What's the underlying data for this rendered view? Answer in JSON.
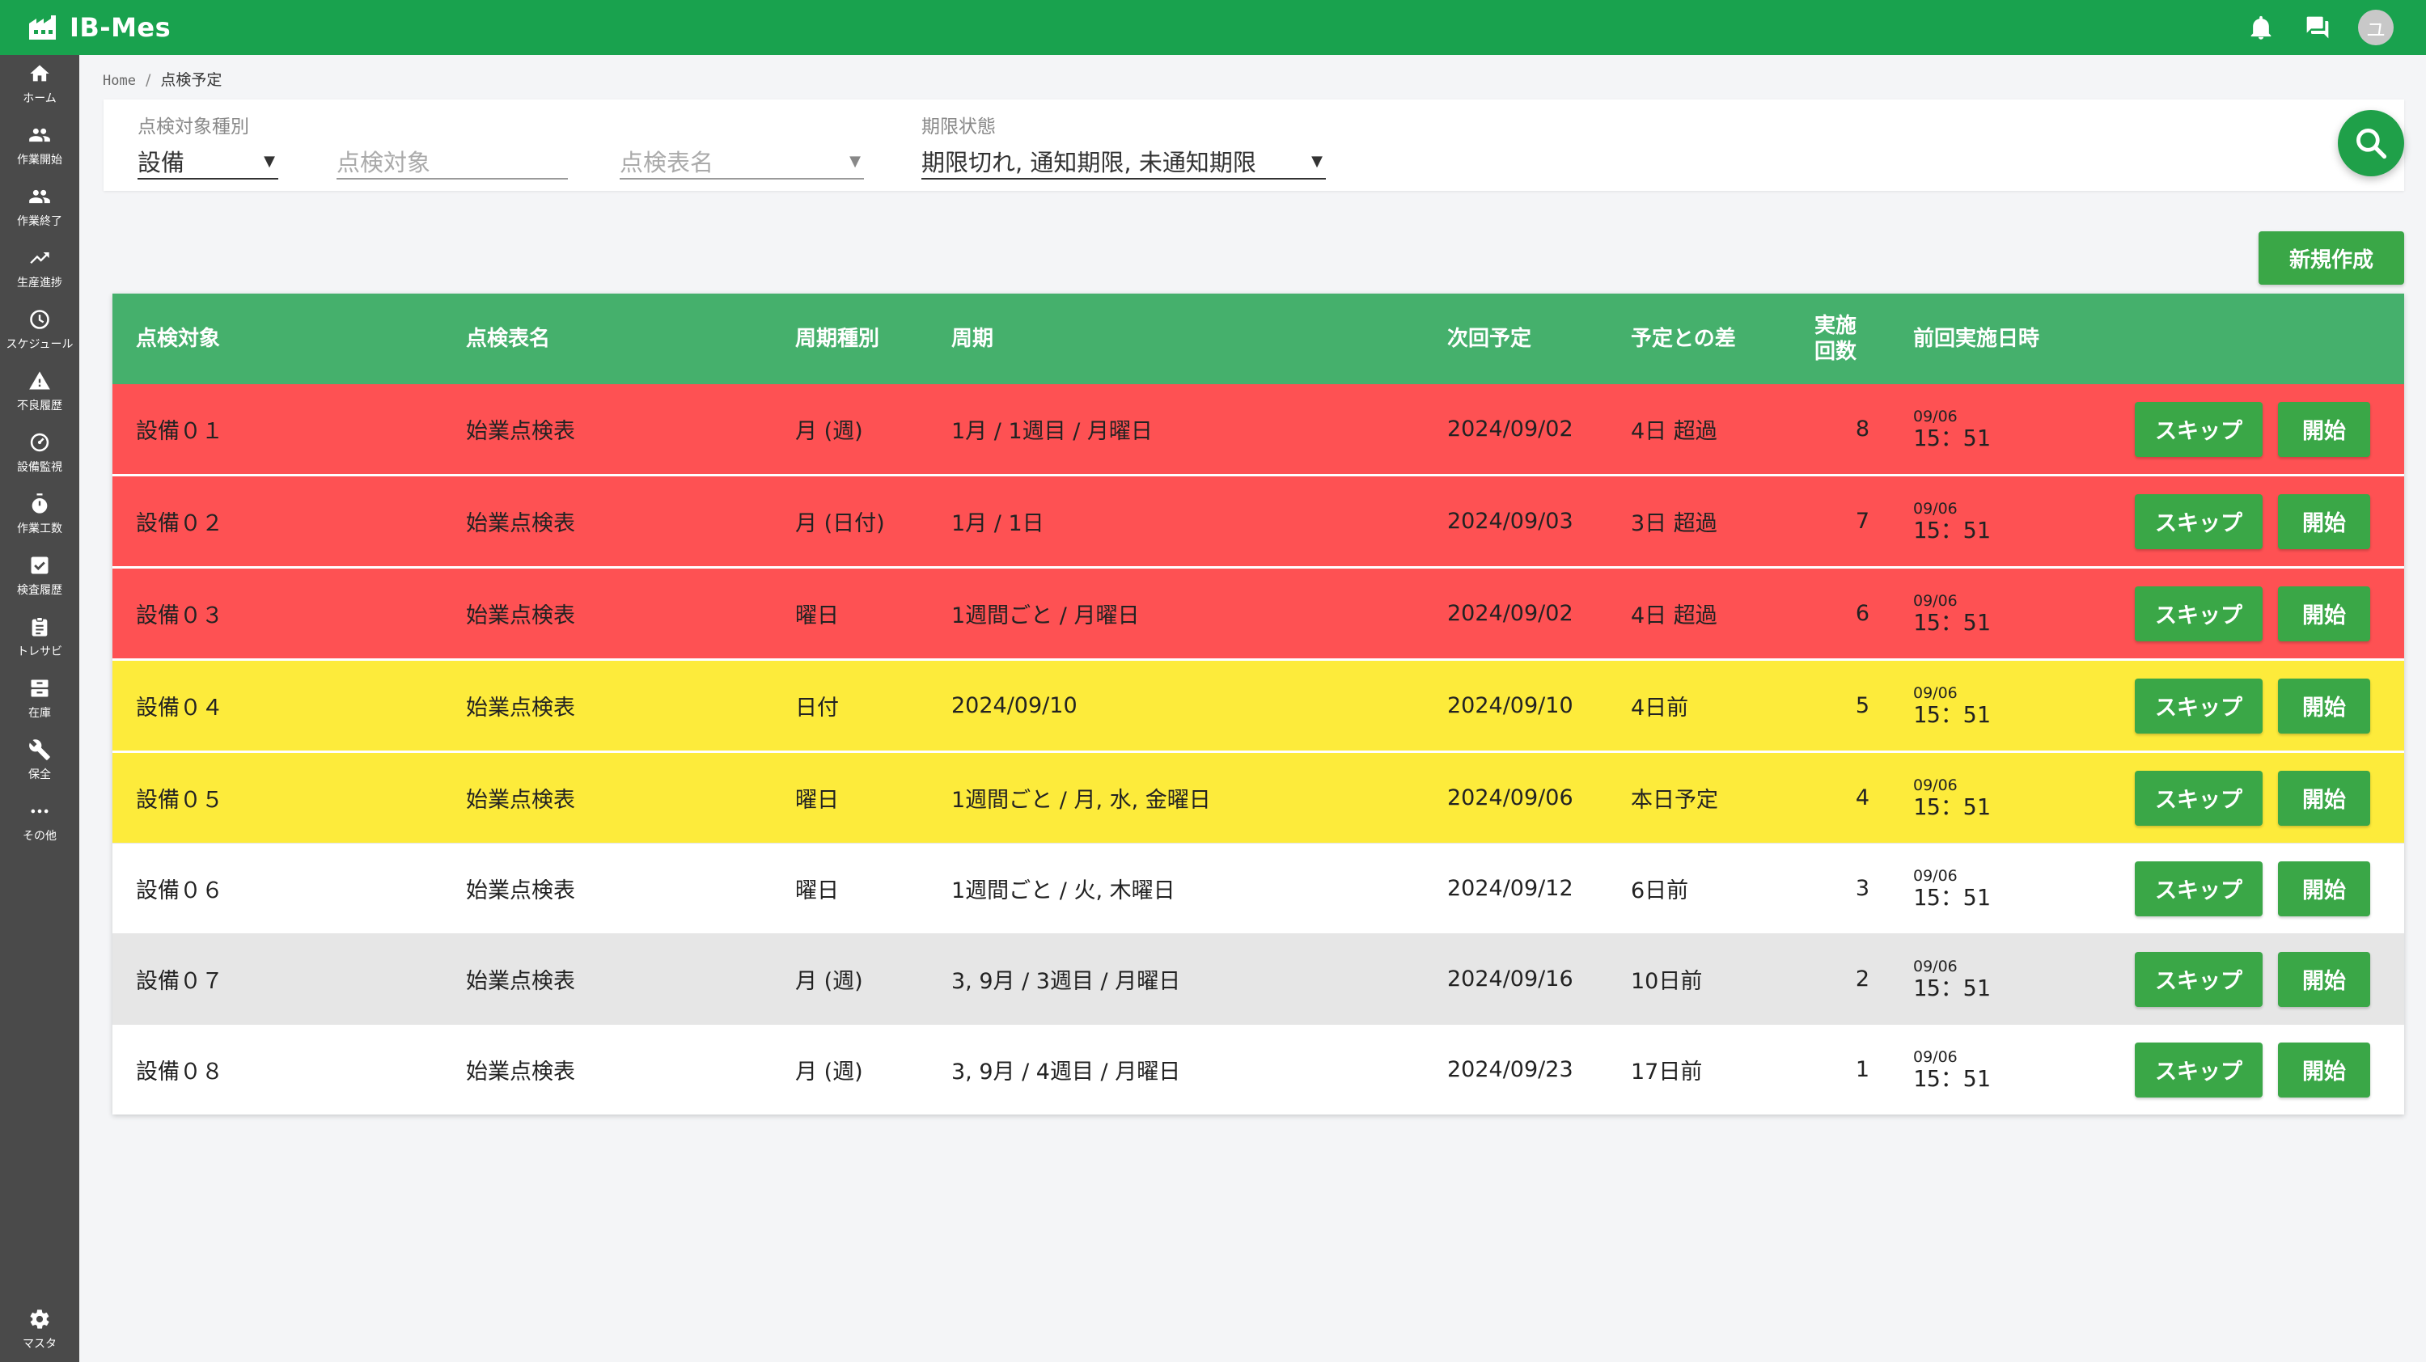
{
  "app": {
    "title": "IB-Mes",
    "avatar_initial": "ユ"
  },
  "sidebar": {
    "items": [
      {
        "label": "ホーム",
        "icon": "home-icon"
      },
      {
        "label": "作業開始",
        "icon": "people-icon"
      },
      {
        "label": "作業終了",
        "icon": "people-icon"
      },
      {
        "label": "生産進捗",
        "icon": "trending-up-icon"
      },
      {
        "label": "スケジュール",
        "icon": "clock-icon"
      },
      {
        "label": "不良履歴",
        "icon": "warning-icon"
      },
      {
        "label": "設備監視",
        "icon": "gauge-icon"
      },
      {
        "label": "作業工数",
        "icon": "stopwatch-icon"
      },
      {
        "label": "検査履歴",
        "icon": "checkbox-icon"
      },
      {
        "label": "トレサビ",
        "icon": "clipboard-icon"
      },
      {
        "label": "在庫",
        "icon": "inventory-icon"
      },
      {
        "label": "保全",
        "icon": "wrench-icon"
      },
      {
        "label": "その他",
        "icon": "more-icon"
      }
    ],
    "master": {
      "label": "マスタ",
      "icon": "gear-icon"
    }
  },
  "breadcrumb": {
    "home": "Home",
    "separator": "/",
    "current": "点検予定"
  },
  "filters": {
    "type_label": "点検対象種別",
    "type_value": "設備",
    "target_placeholder": "点検対象",
    "sheet_placeholder": "点検表名",
    "status_label": "期限状態",
    "status_value": "期限切れ, 通知期限, 未通知期限"
  },
  "new_button": "新規作成",
  "table": {
    "headers": {
      "target": "点検対象",
      "sheet": "点検表名",
      "cycle_type": "周期種別",
      "cycle": "周期",
      "next": "次回予定",
      "diff": "予定との差",
      "count_line1": "実施",
      "count_line2": "回数",
      "last": "前回実施日時"
    },
    "skip_label": "スキップ",
    "start_label": "開始",
    "rows": [
      {
        "target": "設備０１",
        "sheet": "始業点検表",
        "cycle_type": "月 (週)",
        "cycle": "1月 / 1週目 / 月曜日",
        "next": "2024/09/02",
        "diff": "4日 超過",
        "count": "8",
        "last_date": "09/06",
        "last_time": "15：51",
        "status": "red"
      },
      {
        "target": "設備０２",
        "sheet": "始業点検表",
        "cycle_type": "月 (日付)",
        "cycle": "1月 / 1日",
        "next": "2024/09/03",
        "diff": "3日 超過",
        "count": "7",
        "last_date": "09/06",
        "last_time": "15：51",
        "status": "red"
      },
      {
        "target": "設備０３",
        "sheet": "始業点検表",
        "cycle_type": "曜日",
        "cycle": "1週間ごと / 月曜日",
        "next": "2024/09/02",
        "diff": "4日 超過",
        "count": "6",
        "last_date": "09/06",
        "last_time": "15：51",
        "status": "red"
      },
      {
        "target": "設備０４",
        "sheet": "始業点検表",
        "cycle_type": "日付",
        "cycle": "2024/09/10",
        "next": "2024/09/10",
        "diff": "4日前",
        "count": "5",
        "last_date": "09/06",
        "last_time": "15：51",
        "status": "yellow"
      },
      {
        "target": "設備０５",
        "sheet": "始業点検表",
        "cycle_type": "曜日",
        "cycle": "1週間ごと / 月, 水, 金曜日",
        "next": "2024/09/06",
        "diff": "本日予定",
        "count": "4",
        "last_date": "09/06",
        "last_time": "15：51",
        "status": "yellow"
      },
      {
        "target": "設備０６",
        "sheet": "始業点検表",
        "cycle_type": "曜日",
        "cycle": "1週間ごと / 火, 木曜日",
        "next": "2024/09/12",
        "diff": "6日前",
        "count": "3",
        "last_date": "09/06",
        "last_time": "15：51",
        "status": "white"
      },
      {
        "target": "設備０７",
        "sheet": "始業点検表",
        "cycle_type": "月 (週)",
        "cycle": "3, 9月 / 3週目 / 月曜日",
        "next": "2024/09/16",
        "diff": "10日前",
        "count": "2",
        "last_date": "09/06",
        "last_time": "15：51",
        "status": "gray"
      },
      {
        "target": "設備０８",
        "sheet": "始業点検表",
        "cycle_type": "月 (週)",
        "cycle": "3, 9月 / 4週目 / 月曜日",
        "next": "2024/09/23",
        "diff": "17日前",
        "count": "1",
        "last_date": "09/06",
        "last_time": "15：51",
        "status": "white"
      }
    ]
  },
  "colors": {
    "topbar": "#19a24e",
    "sidebar": "#4a4a4a",
    "table_header": "#45b06c",
    "overdue": "#fe5153",
    "warning": "#fdeb3b",
    "button": "#3aa747"
  }
}
